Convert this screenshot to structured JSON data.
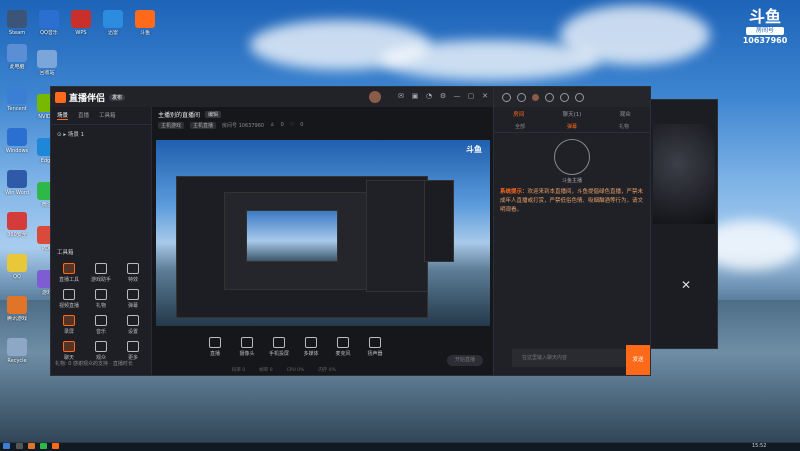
{
  "desktop": {
    "icons_col1": [
      {
        "label": "此电脑",
        "color": "#5a8fd6"
      },
      {
        "label": "Tencent",
        "color": "#3a7fd4"
      },
      {
        "label": "Windows",
        "color": "#2b6fd0"
      },
      {
        "label": "Win Word",
        "color": "#2e5aa8"
      },
      {
        "label": "360安全",
        "color": "#d43b3b"
      },
      {
        "label": "QQ",
        "color": "#e9c73b"
      },
      {
        "label": "腾讯游戏",
        "color": "#e07428"
      },
      {
        "label": "Recycle",
        "color": "#8fa7c6"
      }
    ],
    "icons_col2": [
      {
        "label": "回收站",
        "color": "#7aa6d9"
      },
      {
        "label": "NVIDIA",
        "color": "#76b900"
      },
      {
        "label": "Edge",
        "color": "#1f87d8"
      },
      {
        "label": "微信",
        "color": "#2fb84a"
      },
      {
        "label": "PDF",
        "color": "#d94a3a"
      },
      {
        "label": "游戏",
        "color": "#7e5cd1"
      }
    ],
    "icons_top": [
      {
        "label": "Steam",
        "color": "#3b5478"
      },
      {
        "label": "QQ音乐",
        "color": "#2b6fd0"
      },
      {
        "label": "WPS",
        "color": "#c9302c"
      },
      {
        "label": "迅雷",
        "color": "#2b8ce0"
      },
      {
        "label": "斗鱼",
        "color": "#ff6a1a"
      }
    ]
  },
  "douyu_badge": {
    "logo": "斗鱼",
    "sub": "房间号",
    "room": "10637960"
  },
  "app": {
    "logo": "直播伴侣",
    "version": "发布",
    "left_tabs": [
      "场景",
      "直播",
      "工具箱"
    ],
    "scene_item": "场景 1",
    "tools_title": "工具箱",
    "tools": [
      {
        "label": "直播工具"
      },
      {
        "label": "游戏助手"
      },
      {
        "label": "特效"
      },
      {
        "label": "视频直播"
      },
      {
        "label": "礼物"
      },
      {
        "label": "弹幕"
      },
      {
        "label": "录屏"
      },
      {
        "label": "音乐"
      },
      {
        "label": "设置"
      },
      {
        "label": "聊天"
      },
      {
        "label": "观众"
      },
      {
        "label": "更多"
      }
    ],
    "stream_title": "主播别的直播间",
    "edit_label": "编辑",
    "meta_tags": [
      "主机游戏",
      "主机直播"
    ],
    "meta_room": "房间号 10637960",
    "meta_stats": [
      "0",
      "0"
    ],
    "bottom_buttons": [
      "直播",
      "摄像头",
      "手机投屏",
      "多媒体",
      "麦克风",
      "扬声器"
    ],
    "start_label": "开始直播",
    "status_items": [
      "码率 0",
      "帧率 0",
      "CPU 0%",
      "内存 0%"
    ],
    "notice": "礼物: 0  感谢观众的支持 · 直播时长"
  },
  "chat": {
    "tabs": [
      "房间",
      "聊天(1)",
      "观众"
    ],
    "subtabs": [
      "全部",
      "弹幕",
      "礼物"
    ],
    "nickname": "斗鱼主播",
    "system_prefix": "系统提示：",
    "system_text": "欢迎来到本直播间，斗鱼提倡绿色直播，严禁未成年人直播或打赏，严禁低俗色情、吸烟酗酒等行为，请文明观看。",
    "input_placeholder": "在这里输入聊天内容",
    "send_label": "发送"
  },
  "taskbar": {
    "clock": "15:52"
  }
}
